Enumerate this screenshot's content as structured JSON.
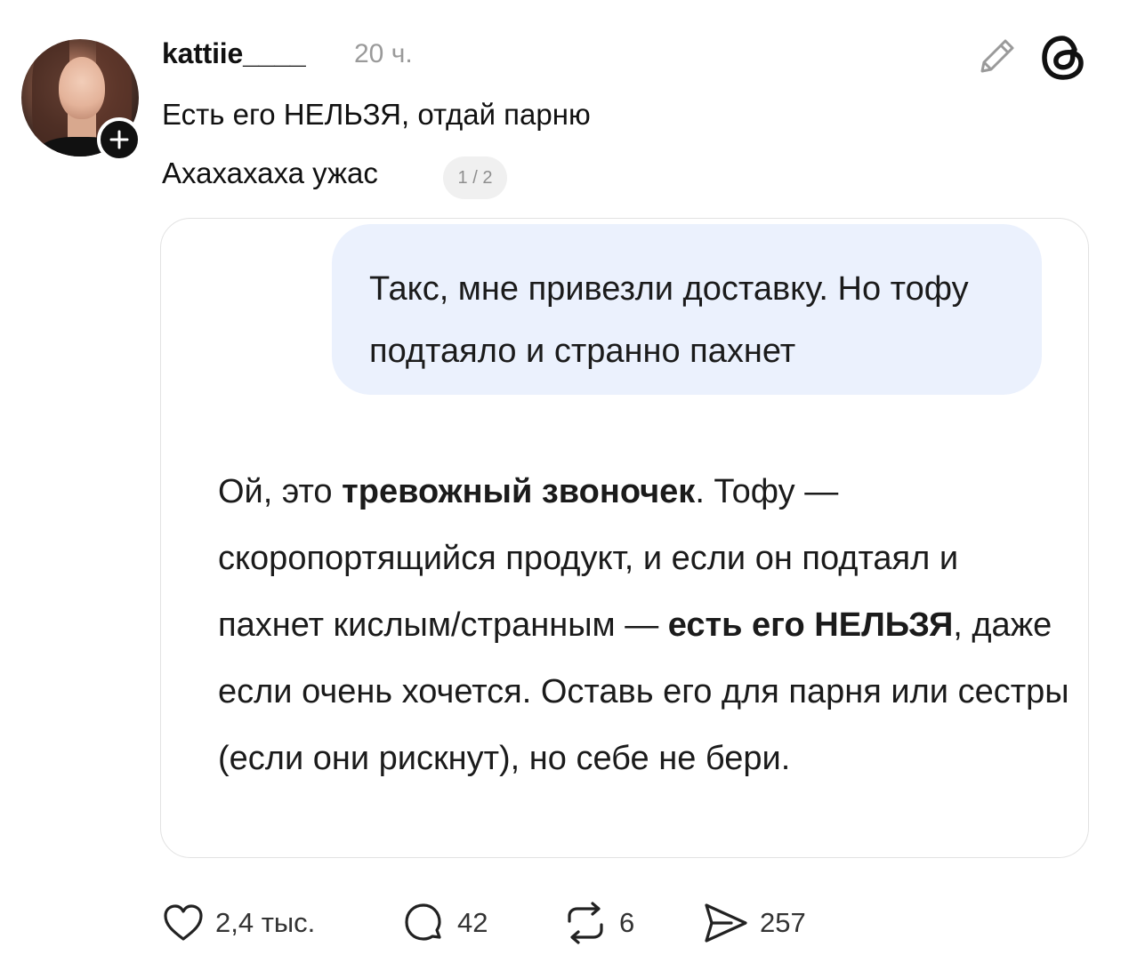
{
  "post": {
    "username": "kattiie____",
    "timestamp": "20 ч.",
    "text_line1": "Есть его НЕЛЬЗЯ, отдай парню",
    "text_line2": "Ахахахаха ужас",
    "page_indicator": "1 / 2"
  },
  "chat_card": {
    "user_message": "Такс, мне привезли доставку. Но тофу подтаяло и странно пахнет",
    "reply": {
      "p1": "Ой, это ",
      "b1": "тревожный звоночек",
      "p2": ". Тофу — скоропортящийся продукт, и если он подтаял и пахнет кислым/странным — ",
      "b2": "есть его НЕЛЬЗЯ",
      "p3": ", даже если очень хочется. Оставь его для парня или сестры (если они рискнут), но себе не бери."
    }
  },
  "actions": {
    "likes": "2,4 тыс.",
    "comments": "42",
    "reposts": "6",
    "shares": "257"
  },
  "icons": {
    "header": [
      "edit-icon",
      "threads-logo-icon"
    ],
    "follow": "plus-icon",
    "actions": [
      "heart-icon",
      "comment-icon",
      "repost-icon",
      "share-icon"
    ]
  }
}
